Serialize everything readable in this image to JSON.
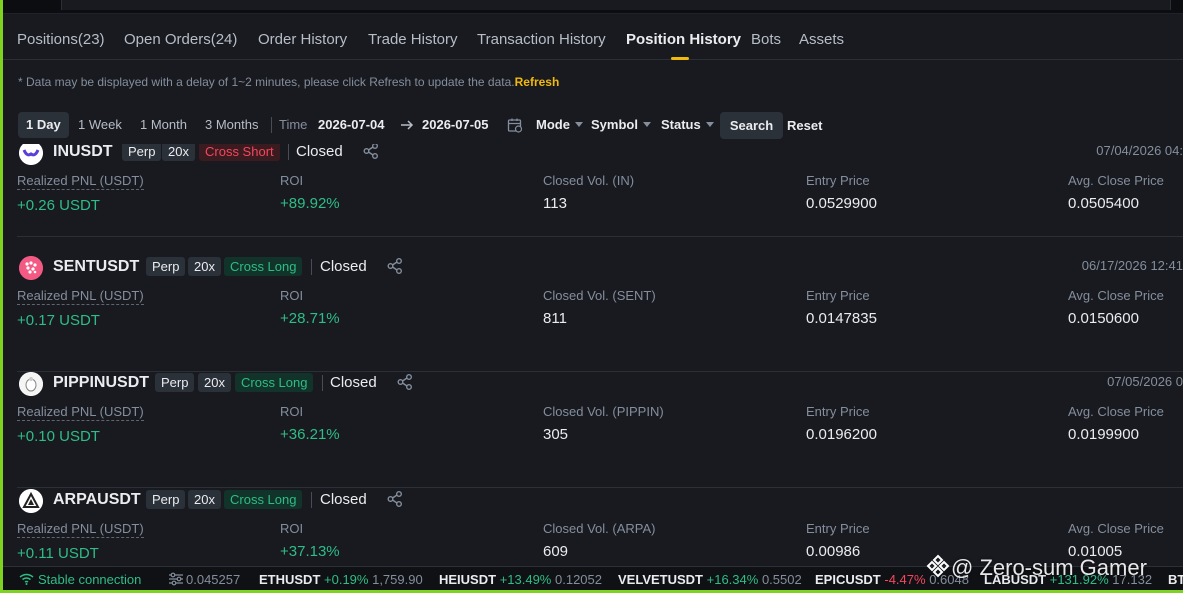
{
  "tabs": [
    {
      "label": "Positions(23)"
    },
    {
      "label": "Open Orders(24)"
    },
    {
      "label": "Order History"
    },
    {
      "label": "Trade History"
    },
    {
      "label": "Transaction History"
    },
    {
      "label": "Position History",
      "active": true
    },
    {
      "label": "Bots"
    },
    {
      "label": "Assets"
    }
  ],
  "notice": {
    "text": "* Data may be displayed with a delay of 1~2 minutes, please click Refresh to update the data.",
    "refresh_label": "Refresh"
  },
  "filters": {
    "ranges": [
      "1 Day",
      "1 Week",
      "1 Month",
      "3 Months"
    ],
    "active_range": "1 Day",
    "time_label": "Time",
    "start_date": "2026-07-04",
    "end_date": "2026-07-05",
    "mode_label": "Mode",
    "symbol_label": "Symbol",
    "status_label": "Status",
    "search_label": "Search",
    "reset_label": "Reset"
  },
  "columns": {
    "pnl": "Realized PNL (USDT)",
    "roi": "ROI",
    "entry": "Entry Price",
    "close": "Avg. Close Price"
  },
  "positions": [
    {
      "symbol": "INUSDT",
      "type": "Perp",
      "leverage": "20x",
      "side": "Cross Short",
      "side_kind": "short",
      "status": "Closed",
      "time": "07/04/2026 04:",
      "pnl": "+0.26 USDT",
      "roi": "+89.92%",
      "vol_label": "Closed Vol. (IN)",
      "vol": "113",
      "entry": "0.0529900",
      "close": "0.0505400"
    },
    {
      "symbol": "SENTUSDT",
      "type": "Perp",
      "leverage": "20x",
      "side": "Cross Long",
      "side_kind": "long",
      "status": "Closed",
      "time": "06/17/2026 12:41",
      "pnl": "+0.17 USDT",
      "roi": "+28.71%",
      "vol_label": "Closed Vol. (SENT)",
      "vol": "811",
      "entry": "0.0147835",
      "close": "0.0150600"
    },
    {
      "symbol": "PIPPINUSDT",
      "type": "Perp",
      "leverage": "20x",
      "side": "Cross Long",
      "side_kind": "long",
      "status": "Closed",
      "time": "07/05/2026 0",
      "pnl": "+0.10 USDT",
      "roi": "+36.21%",
      "vol_label": "Closed Vol. (PIPPIN)",
      "vol": "305",
      "entry": "0.0196200",
      "close": "0.0199900"
    },
    {
      "symbol": "ARPAUSDT",
      "type": "Perp",
      "leverage": "20x",
      "side": "Cross Long",
      "side_kind": "long",
      "status": "Closed",
      "time": "",
      "pnl": "+0.11 USDT",
      "roi": "+37.13%",
      "vol_label": "Closed Vol. (ARPA)",
      "vol": "609",
      "entry": "0.00986",
      "close": "0.01005"
    }
  ],
  "statusbar": {
    "connection": "Stable connection",
    "partial_price": "0.045257",
    "tickers": [
      {
        "symbol": "ETHUSDT",
        "change": "+0.19%",
        "price": "1,759.90"
      },
      {
        "symbol": "HEIUSDT",
        "change": "+13.49%",
        "price": "0.12052"
      },
      {
        "symbol": "VELVETUSDT",
        "change": "+16.34%",
        "price": "0.5502"
      },
      {
        "symbol": "EPICUSDT",
        "change": "-4.47%",
        "price": "0.6048"
      },
      {
        "symbol": "LABUSDT",
        "change": "+131.92%",
        "price": "17.132"
      },
      {
        "symbol": "BT",
        "change": "",
        "price": ""
      }
    ]
  },
  "watermark": "@ Zero-sum Gamer",
  "colors": {
    "accent": "#f0b90b",
    "up": "#2ebd85",
    "down": "#f6465d"
  }
}
